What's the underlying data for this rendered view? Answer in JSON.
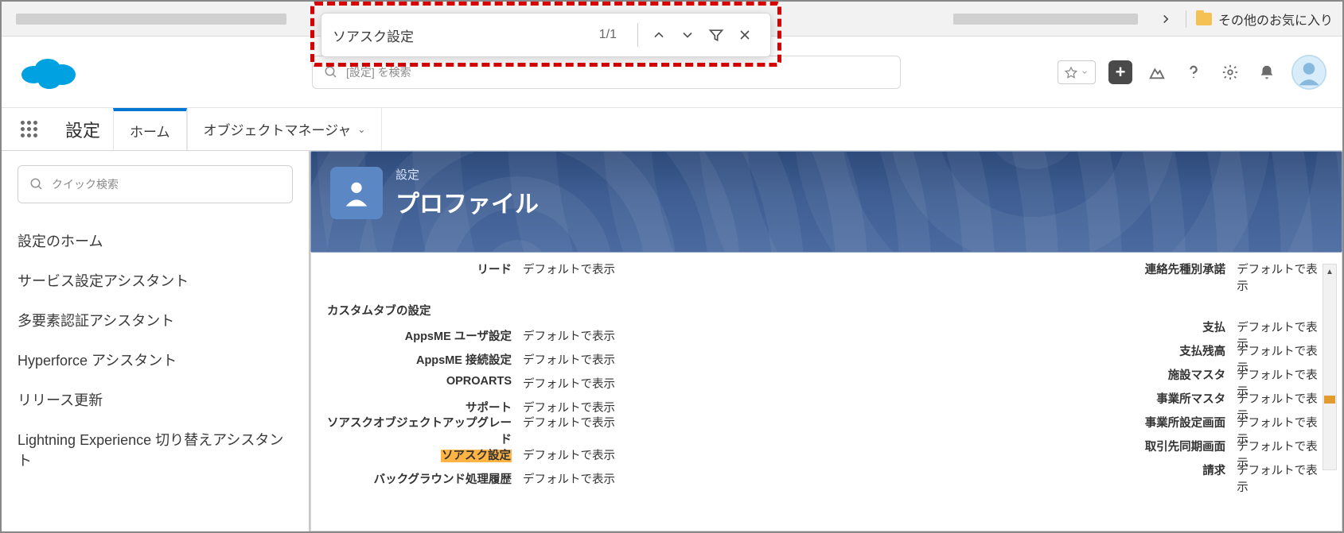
{
  "browser": {
    "other_favorites": "その他のお気に入り"
  },
  "find": {
    "query": "ソアスク設定",
    "count": "1/1"
  },
  "header": {
    "search_placeholder": "[設定] を検索"
  },
  "nav": {
    "title": "設定",
    "tab_home": "ホーム",
    "tab_obj_mgr": "オブジェクトマネージャ"
  },
  "sidebar": {
    "quick_find_placeholder": "クイック検索",
    "links": [
      "設定のホーム",
      "サービス設定アシスタント",
      "多要素認証アシスタント",
      "Hyperforce アシスタント",
      "リリース更新",
      "Lightning Experience 切り替えアシスタント"
    ]
  },
  "banner": {
    "eyebrow": "設定",
    "title": "プロファイル"
  },
  "lead": {
    "left_label": "リード",
    "left_value": "デフォルトで表示",
    "right_label": "連絡先種別承諾",
    "right_value": "デフォルトで表示"
  },
  "section": {
    "custom_tabs": "カスタムタブの設定"
  },
  "rows": [
    {
      "l_label": "AppsME ユーザ設定",
      "l_value": "デフォルトで表示",
      "r_label": "支払",
      "r_value": "デフォルトで表示"
    },
    {
      "l_label": "AppsME 接続設定",
      "l_value": "デフォルトで表示",
      "r_label": "支払残高",
      "r_value": "デフォルトで表示"
    },
    {
      "l_label": "OPROARTS",
      "l_value": "デフォルトで表示",
      "r_label": "施設マスタ",
      "r_value": "デフォルトで表示"
    },
    {
      "l_label": "サポート",
      "l_value": "デフォルトで表示",
      "r_label": "事業所マスタ",
      "r_value": "デフォルトで表示"
    },
    {
      "l_label": "ソアスクオブジェクトアップグレード",
      "l_value": "デフォルトで表示",
      "r_label": "事業所設定画面",
      "r_value": "デフォルトで表示"
    },
    {
      "l_label": "ソアスク設定",
      "l_value": "デフォルトで表示",
      "r_label": "取引先同期画面",
      "r_value": "デフォルトで表示",
      "highlight": true
    },
    {
      "l_label": "バックグラウンド処理履歴",
      "l_value": "デフォルトで表示",
      "r_label": "請求",
      "r_value": "デフォルトで表示"
    }
  ]
}
